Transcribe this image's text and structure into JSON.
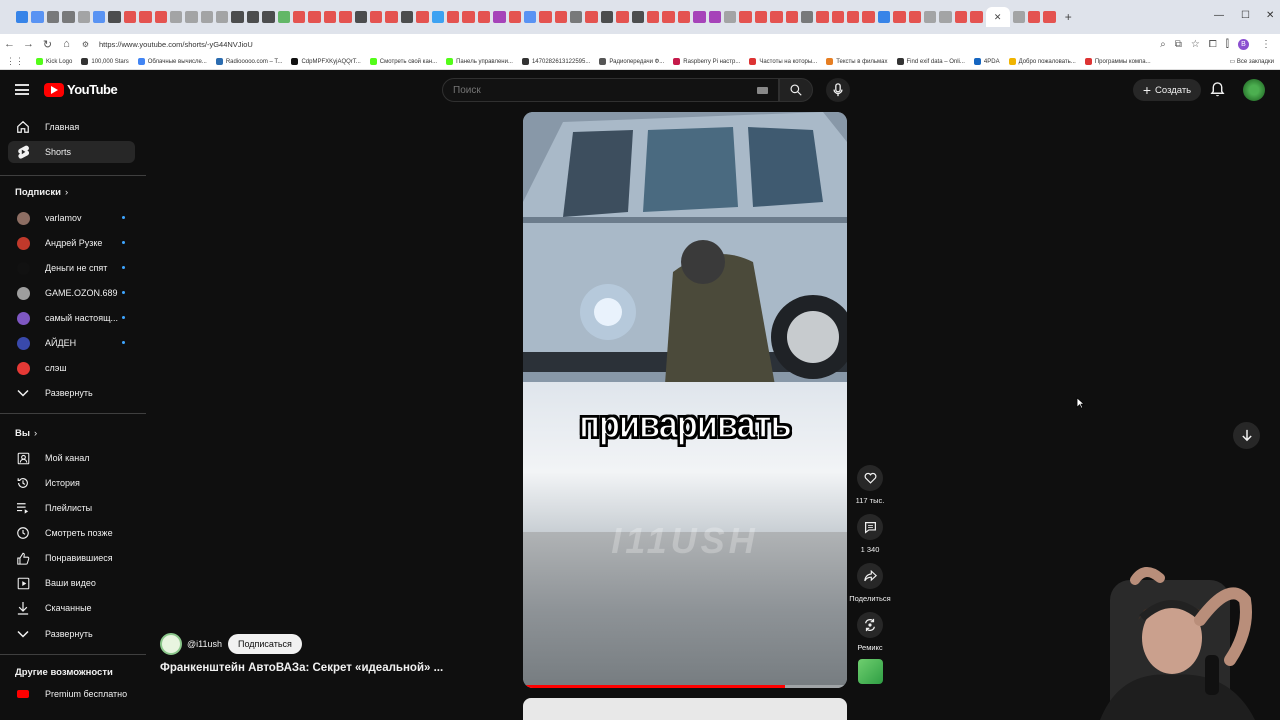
{
  "browser": {
    "url": "https://www.youtube.com/shorts/-yG44NVJioU",
    "profile_initial": "B",
    "tab_colors": [
      "#1a73e8",
      "#4285f4",
      "#666",
      "#666",
      "#999",
      "#4285f4",
      "#333",
      "#e53935",
      "#e53935",
      "#e53935",
      "#999",
      "#999",
      "#999",
      "#999",
      "#333",
      "#333",
      "#333",
      "#4caf50",
      "#e53935",
      "#e53935",
      "#e53935",
      "#e53935",
      "#333",
      "#e53935",
      "#e53935",
      "#333",
      "#e53935",
      "#2196f3",
      "#e53935",
      "#e53935",
      "#e53935",
      "#9c27b0",
      "#e53935",
      "#4285f4",
      "#e53935",
      "#e53935",
      "#666",
      "#e53935",
      "#333",
      "#e53935",
      "#333",
      "#e53935",
      "#e53935",
      "#e53935",
      "#9c27b0",
      "#9c27b0",
      "#999",
      "#e53935",
      "#e53935",
      "#e53935",
      "#e53935",
      "#666",
      "#e53935",
      "#e53935",
      "#e53935",
      "#e53935",
      "#1a73e8",
      "#e53935",
      "#e53935",
      "#999",
      "#999",
      "#e53935",
      "#e53935",
      "#999",
      "#e53935",
      "#e53935"
    ],
    "new_tab": "+",
    "bookmarks": [
      {
        "label": "Kick Logo",
        "color": "#53fc18"
      },
      {
        "label": "100,000 Stars",
        "color": "#333"
      },
      {
        "label": "Облачные вычисле...",
        "color": "#4285f4"
      },
      {
        "label": "Radiooooo.com – T...",
        "color": "#2b6cb0"
      },
      {
        "label": "CdpMPFXKyjAQQrT...",
        "color": "#111"
      },
      {
        "label": "Смотреть свой кан...",
        "color": "#53fc18"
      },
      {
        "label": "Панель управлени...",
        "color": "#53fc18"
      },
      {
        "label": "14702826131225​95...",
        "color": "#333"
      },
      {
        "label": "Радиопередачи Ф...",
        "color": "#555"
      },
      {
        "label": "Raspberry Pi настр...",
        "color": "#c51a4a"
      },
      {
        "label": "Частоты на которы...",
        "color": "#d33"
      },
      {
        "label": "Тексты в фильмах",
        "color": "#e67e22"
      },
      {
        "label": "Find exif data – Onli...",
        "color": "#333"
      },
      {
        "label": "4PDA",
        "color": "#1565c0"
      },
      {
        "label": "Добро пожаловать...",
        "color": "#f0b400"
      },
      {
        "label": "Программы компа...",
        "color": "#d33"
      }
    ],
    "bookmarks_all": "Все закладки"
  },
  "header": {
    "logo_text": "YouTube",
    "search_placeholder": "Поиск",
    "create_label": "Создать"
  },
  "sidebar": {
    "main": [
      {
        "label": "Главная",
        "icon": "home-icon"
      },
      {
        "label": "Shorts",
        "icon": "shorts-icon",
        "active": true
      }
    ],
    "subscriptions_heading": "Подписки",
    "chevron": "›",
    "channels": [
      {
        "label": "varlamov",
        "color": "#8d6e63"
      },
      {
        "label": "Андрей Рузке",
        "color": "#c0392b"
      },
      {
        "label": "Деньги не спят",
        "color": "#111"
      },
      {
        "label": "GAME.OZON.689",
        "color": "#9e9e9e"
      },
      {
        "label": "самый настоящ...",
        "color": "#7e57c2"
      },
      {
        "label": "АЙДЕН",
        "color": "#3949ab"
      },
      {
        "label": "слэш",
        "color": "#e53935"
      }
    ],
    "expand_label": "Развернуть",
    "you_heading": "Вы",
    "you_items": [
      {
        "label": "Мой канал",
        "icon": "my-channel-icon"
      },
      {
        "label": "История",
        "icon": "history-icon"
      },
      {
        "label": "Плейлисты",
        "icon": "playlists-icon"
      },
      {
        "label": "Смотреть позже",
        "icon": "watch-later-icon"
      },
      {
        "label": "Понравившиеся",
        "icon": "liked-icon"
      },
      {
        "label": "Ваши видео",
        "icon": "your-videos-icon"
      },
      {
        "label": "Скачанные",
        "icon": "downloads-icon"
      }
    ],
    "expand2_label": "Развернуть",
    "more_heading": "Другие возможности",
    "premium_label": "Premium бесплатно"
  },
  "short": {
    "caption": "приваривать",
    "watermark": "I11USH",
    "progress": 0.81,
    "channel_handle": "@i11ush",
    "subscribe_label": "Подписаться",
    "title": "Франкенштейн АвтоВАЗа: Секрет «идеальной» ..."
  },
  "actions": {
    "likes": "117 тыс.",
    "comments": "1 340",
    "share": "Поделиться",
    "remix": "Ремикс"
  },
  "colors": {
    "brand_red": "#ff0000",
    "background": "#0f0f0f",
    "subscription_dot": "#3ea6ff"
  }
}
